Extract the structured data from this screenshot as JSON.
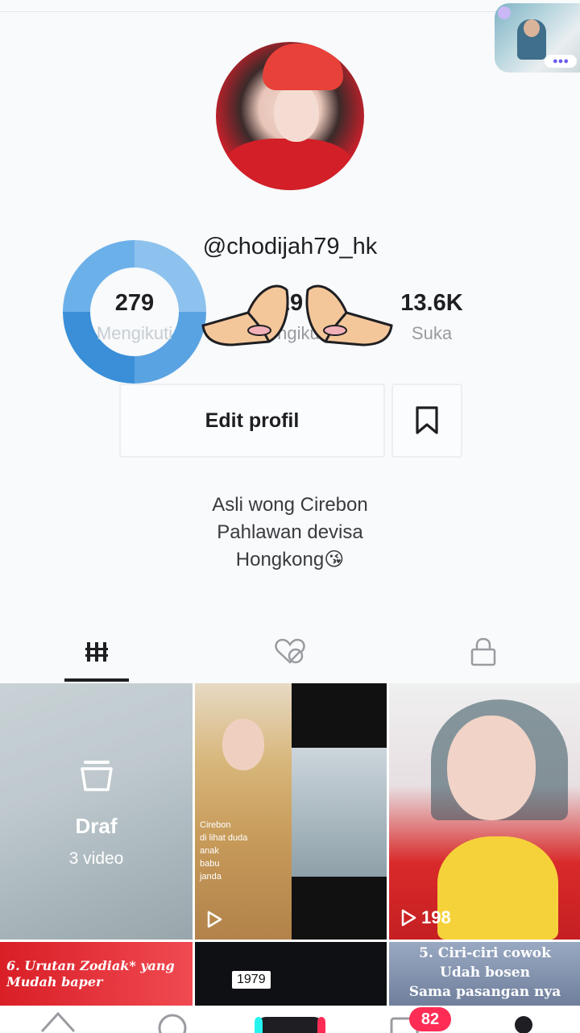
{
  "profile": {
    "username": "@chodijah79_hk",
    "bio_lines": [
      "Asli wong Cirebon",
      "Pahlawan devisa",
      "Hongkong😘"
    ]
  },
  "stats": [
    {
      "value": "279",
      "label": "Mengikuti"
    },
    {
      "value": "29",
      "label": "Pengikut"
    },
    {
      "value": "13.6K",
      "label": "Suka"
    }
  ],
  "actions": {
    "edit_profile_label": "Edit profil"
  },
  "tabs": [
    {
      "icon": "grid-icon",
      "active": true
    },
    {
      "icon": "liked-hidden-icon",
      "active": false
    },
    {
      "icon": "lock-icon",
      "active": false
    }
  ],
  "videos": {
    "draft": {
      "title": "Draf",
      "count": "3 video"
    },
    "items": [
      {
        "views": "",
        "caption": "Cirebon\ndi lihat duda\nanak\nbabu\njanda"
      },
      {
        "views": "198"
      }
    ],
    "row2": [
      {
        "caption": "6. Urutan Zodiak* yang\nMudah baper"
      },
      {
        "badge": "1979"
      },
      {
        "caption": "5. Ciri-ciri cowok\nUdah bosen\nSama pasangan nya"
      }
    ]
  },
  "bottom_nav": {
    "inbox_badge": "82"
  },
  "colors": {
    "ring_accent": "#3a8fd8",
    "badge": "#ff2d55"
  }
}
